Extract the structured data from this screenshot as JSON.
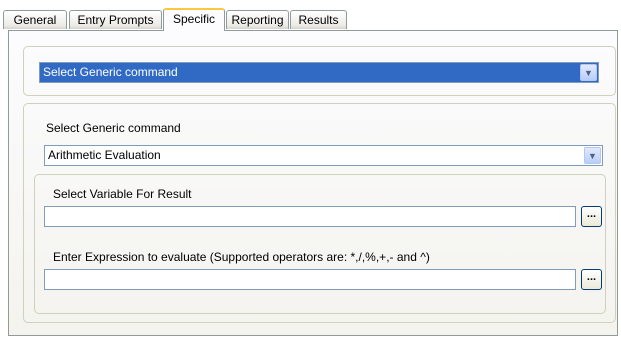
{
  "tabs": [
    {
      "label": "General"
    },
    {
      "label": "Entry Prompts"
    },
    {
      "label": "Specific",
      "active": true
    },
    {
      "label": "Reporting"
    },
    {
      "label": "Results"
    }
  ],
  "top_combo": {
    "value": "Select Generic command"
  },
  "generic": {
    "label": "Select Generic command",
    "value": "Arithmetic Evaluation"
  },
  "variable": {
    "label": "Select Variable For Result",
    "value": "",
    "browse_label": "..."
  },
  "expression": {
    "label": "Enter Expression to evaluate (Supported operators are: *,/,%,+,- and ^)",
    "value": "",
    "browse_label": "..."
  },
  "icons": {
    "dropdown": "chevron-down-icon"
  }
}
